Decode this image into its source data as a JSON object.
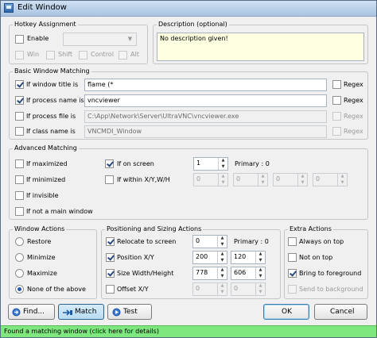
{
  "window": {
    "title": "Edit Window"
  },
  "hotkey": {
    "legend": "Hotkey Assignment",
    "enable_label": "Enable",
    "mods": [
      "Win",
      "Shift",
      "Control",
      "Alt"
    ]
  },
  "description": {
    "legend": "Description (optional)",
    "value": "No description given!"
  },
  "basic": {
    "legend": "Basic Window Matching",
    "rows": [
      {
        "label": "If window title is",
        "value": "flame (*",
        "checked": true,
        "regex_label": "Regex"
      },
      {
        "label": "If process name is",
        "value": "vncviewer",
        "checked": true,
        "regex_label": "Regex"
      },
      {
        "label": "If process file is",
        "value": "C:\\App\\Network\\Server\\UltraVNC\\vncviewer.exe",
        "checked": false,
        "regex_label": "Regex"
      },
      {
        "label": "If class name is",
        "value": "VNCMDI_Window",
        "checked": false,
        "regex_label": "Regex"
      }
    ]
  },
  "advanced": {
    "legend": "Advanced Matching",
    "if_maximized": "If maximized",
    "if_minimized": "If minimized",
    "if_invisible": "If invisible",
    "if_not_main": "If not a main window",
    "if_on_screen": "If on screen",
    "screen_value": "1",
    "primary_text": "Primary : 0",
    "if_within": "If within X/Y,W/H",
    "within_values": [
      "0",
      "0",
      "0",
      "0"
    ]
  },
  "window_actions": {
    "legend": "Window Actions",
    "options": [
      "Restore",
      "Minimize",
      "Maximize",
      "None of the above"
    ],
    "selected": "None of the above"
  },
  "positioning": {
    "legend": "Positioning and Sizing Actions",
    "relocate_label": "Relocate to screen",
    "relocate_value": "0",
    "primary_text": "Primary : 0",
    "position_label": "Position X/Y",
    "pos_x": "200",
    "pos_y": "120",
    "size_label": "Size Width/Height",
    "width": "778",
    "height": "606",
    "offset_label": "Offset X/Y",
    "offset_x": "0",
    "offset_y": "0"
  },
  "extra": {
    "legend": "Extra Actions",
    "always_on_top": "Always on top",
    "not_on_top": "Not on top",
    "bring_to_foreground": "Bring to foreground",
    "send_to_background": "Send to background"
  },
  "buttons": {
    "find": "Find...",
    "match": "Match",
    "test": "Test",
    "ok": "OK",
    "cancel": "Cancel"
  },
  "status": {
    "text": "Found a matching window (click here for details)"
  },
  "colors": {
    "status_bg": "#7ee87e",
    "description_bg": "#ffffe1"
  }
}
